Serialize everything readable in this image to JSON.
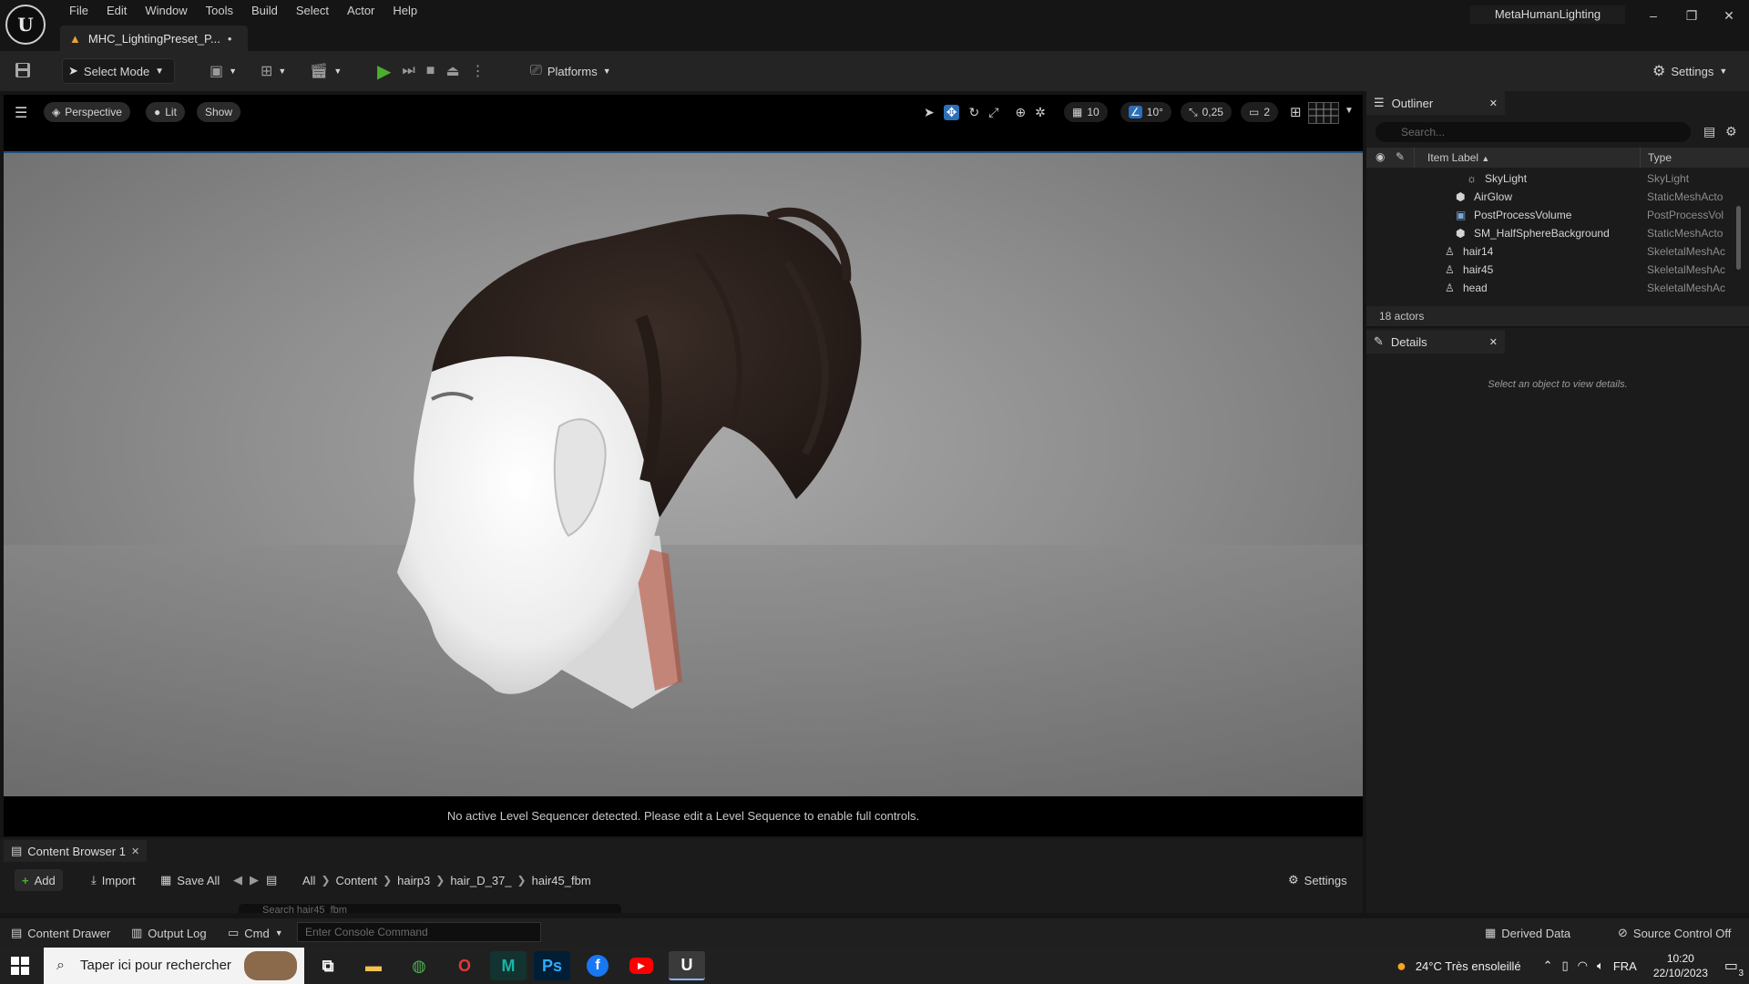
{
  "menu": [
    "File",
    "Edit",
    "Window",
    "Tools",
    "Build",
    "Select",
    "Actor",
    "Help"
  ],
  "document_tab": {
    "label": "MHC_LightingPreset_P...",
    "modified": "•"
  },
  "project_name": "MetaHumanLighting",
  "window_controls": {
    "minimize": "–",
    "maximize": "❐",
    "close": "✕"
  },
  "toolbar": {
    "select_mode": "Select Mode",
    "platforms": "Platforms",
    "settings": "Settings"
  },
  "viewport": {
    "perspective": "Perspective",
    "lit": "Lit",
    "show": "Show",
    "grid_snap": "10",
    "rotation_snap": "10°",
    "scale_snap": "0,25",
    "camera_speed": "2",
    "sequencer_message": "No active Level Sequencer detected. Please edit a Level Sequence to enable full controls."
  },
  "outliner": {
    "title": "Outliner",
    "search_placeholder": "Search...",
    "col_label": "Item Label",
    "col_type": "Type",
    "rows": [
      {
        "label": "SkyLight",
        "type": "SkyLight",
        "icon": "skylight-icon"
      },
      {
        "label": "AirGlow",
        "type": "StaticMeshActo",
        "icon": "static-mesh-icon"
      },
      {
        "label": "PostProcessVolume",
        "type": "PostProcessVol",
        "icon": "volume-icon"
      },
      {
        "label": "SM_HalfSphereBackground",
        "type": "StaticMeshActo",
        "icon": "static-mesh-icon"
      },
      {
        "label": "hair14",
        "type": "SkeletalMeshAc",
        "icon": "skeletal-mesh-icon"
      },
      {
        "label": "hair45",
        "type": "SkeletalMeshAc",
        "icon": "skeletal-mesh-icon"
      },
      {
        "label": "head",
        "type": "SkeletalMeshAc",
        "icon": "skeletal-mesh-icon"
      }
    ],
    "count": "18 actors"
  },
  "details": {
    "title": "Details",
    "empty_message": "Select an object to view details."
  },
  "content_browser": {
    "tab": "Content Browser 1",
    "add": "Add",
    "import": "Import",
    "save_all": "Save All",
    "breadcrumb": [
      "All",
      "Content",
      "hairp3",
      "hair_D_37_",
      "hair45_fbm"
    ],
    "settings": "Settings",
    "search_placeholder": "Search hair45_fbm"
  },
  "statusbar": {
    "content_drawer": "Content Drawer",
    "output_log": "Output Log",
    "cmd": "Cmd",
    "console_placeholder": "Enter Console Command",
    "derived_data": "Derived Data",
    "source_control": "Source Control Off"
  },
  "taskbar": {
    "search_placeholder": "Taper ici pour rechercher",
    "weather": "24°C  Très ensoleillé",
    "language": "FRA",
    "time": "10:20",
    "date": "22/10/2023",
    "notifications": "3"
  },
  "colors": {
    "accent_blue": "#2d6fb7",
    "play_green": "#4caf2b",
    "panel_bg": "#1b1b1b"
  }
}
